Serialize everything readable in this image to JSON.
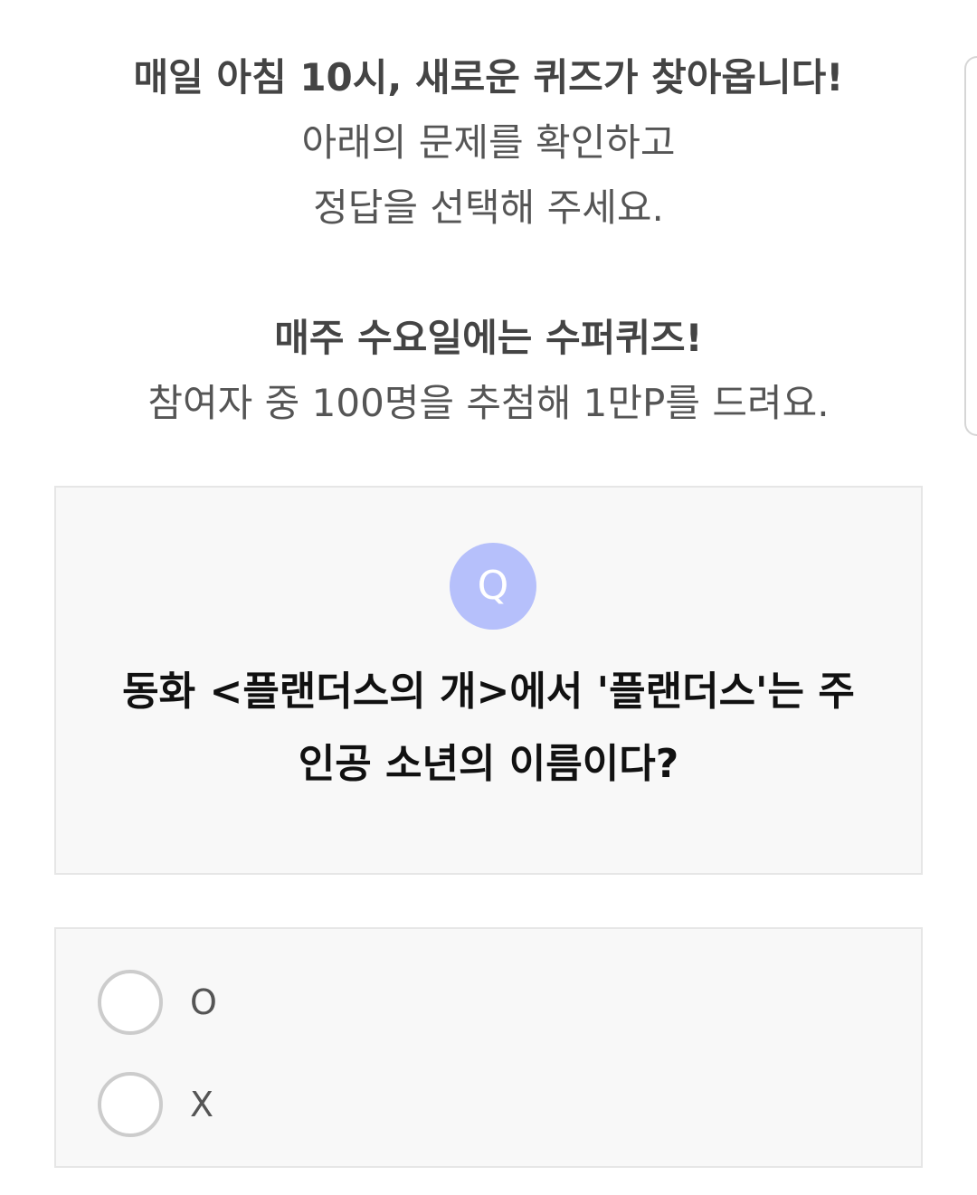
{
  "intro": {
    "line1": "매일 아침 10시, 새로운 퀴즈가 찾아옵니다!",
    "line2": "아래의 문제를 확인하고",
    "line3": "정답을 선택해 주세요.",
    "line4": "매주 수요일에는 수퍼퀴즈!",
    "line5": "참여자 중 100명을 추첨해 1만P를 드려요."
  },
  "question": {
    "badge": "Q",
    "line1": "동화 <플랜더스의 개>에서 '플랜더스'는 주",
    "line2": "인공 소년의 이름이다?"
  },
  "answers": [
    {
      "label": "O"
    },
    {
      "label": "X"
    }
  ],
  "colors": {
    "badge": "#b6c0fb",
    "card_bg": "#f8f8f8",
    "card_border": "#e6e6e6",
    "radio_border": "#cccccc",
    "question_text": "#111111"
  }
}
